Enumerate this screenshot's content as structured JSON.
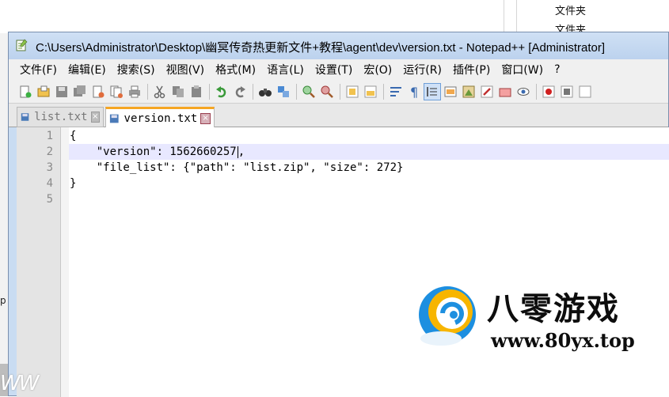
{
  "background": {
    "folder_label_1": "文件夹",
    "folder_label_2": "文件夹",
    "left_fragment": "p",
    "bottom_left_fragment": "WW"
  },
  "window": {
    "title": "C:\\Users\\Administrator\\Desktop\\幽冥传奇热更新文件+教程\\agent\\dev\\version.txt - Notepad++ [Administrator]"
  },
  "menu": [
    {
      "label": "文件(F)",
      "name": "menu-file"
    },
    {
      "label": "编辑(E)",
      "name": "menu-edit"
    },
    {
      "label": "搜索(S)",
      "name": "menu-search"
    },
    {
      "label": "视图(V)",
      "name": "menu-view"
    },
    {
      "label": "格式(M)",
      "name": "menu-format"
    },
    {
      "label": "语言(L)",
      "name": "menu-language"
    },
    {
      "label": "设置(T)",
      "name": "menu-settings"
    },
    {
      "label": "宏(O)",
      "name": "menu-macro"
    },
    {
      "label": "运行(R)",
      "name": "menu-run"
    },
    {
      "label": "插件(P)",
      "name": "menu-plugins"
    },
    {
      "label": "窗口(W)",
      "name": "menu-window"
    },
    {
      "label": "?",
      "name": "menu-help"
    }
  ],
  "tabs": [
    {
      "label": "list.txt",
      "active": false
    },
    {
      "label": "version.txt",
      "active": true
    }
  ],
  "editor": {
    "line_numbers": [
      "1",
      "2",
      "3",
      "4",
      "5"
    ],
    "lines": [
      "{",
      "    \"version\": 1562660257,",
      "    \"file_list\": {\"path\": \"list.zip\", \"size\": 272}",
      "}",
      ""
    ]
  },
  "watermark": {
    "brand": "八零游戏",
    "url": "www.80yx.top"
  },
  "colors": {
    "title_bg": "#c9dcf2",
    "tab_accent": "#f5a623",
    "current_line": "#e8e8ff"
  }
}
